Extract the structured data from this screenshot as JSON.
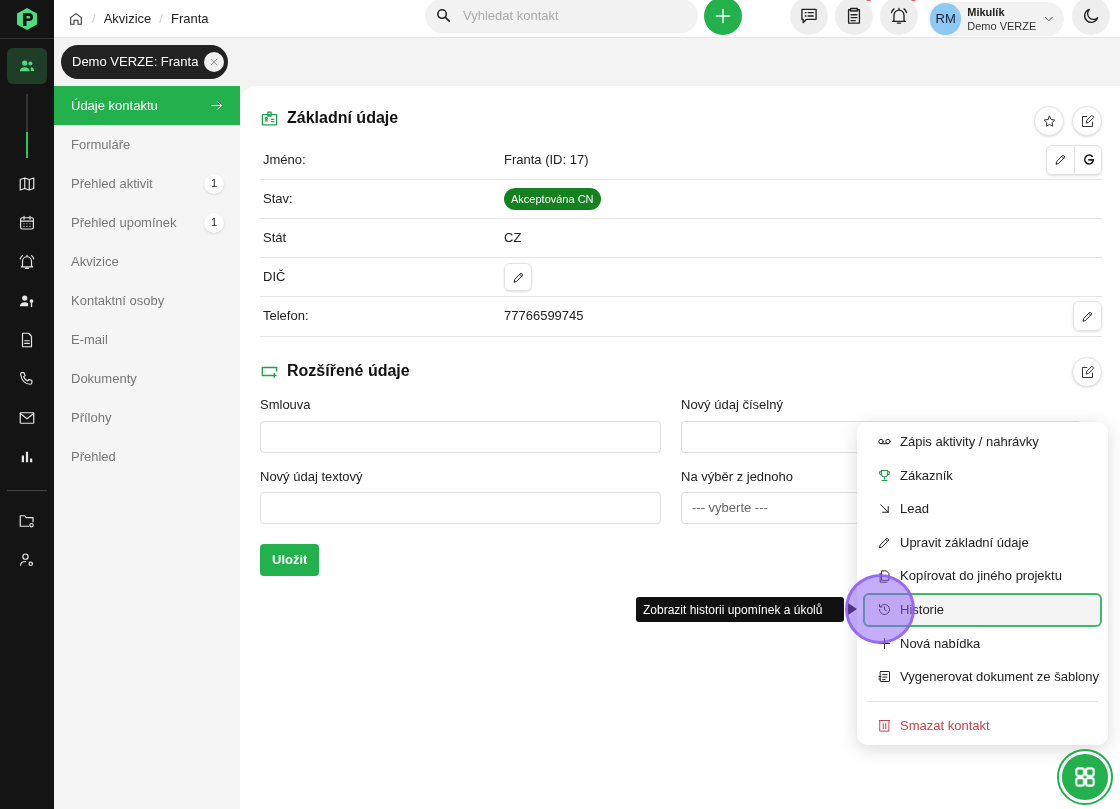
{
  "breadcrumb": [
    {
      "kind": "separator",
      "text": "/"
    },
    {
      "kind": "link",
      "text": "Akvizice"
    },
    {
      "kind": "separator",
      "text": "/"
    },
    {
      "kind": "link",
      "text": "Franta"
    }
  ],
  "search": {
    "placeholder": "Vyhledat kontakt"
  },
  "header_buttons": [
    {
      "kind": "chat",
      "badge": false
    },
    {
      "kind": "clipboard",
      "badge": true
    },
    {
      "kind": "bell",
      "badge": true
    }
  ],
  "user": {
    "initials": "RM",
    "name": "Mikulík",
    "project": "Demo VERZE"
  },
  "rail": [
    {
      "kind": "users",
      "selected": true
    },
    {
      "kind": "map",
      "selected": false
    },
    {
      "kind": "calendar",
      "selected": false
    },
    {
      "kind": "bell",
      "selected": false
    },
    {
      "kind": "user-key",
      "selected": false
    },
    {
      "kind": "document",
      "selected": false
    },
    {
      "kind": "phone",
      "selected": false
    },
    {
      "kind": "mail",
      "selected": false
    },
    {
      "kind": "chart",
      "selected": false
    },
    {
      "kind": "folder-gear",
      "selected": false
    },
    {
      "kind": "user-gear",
      "selected": false
    }
  ],
  "chip": {
    "label": "Demo VERZE: Franta"
  },
  "nav": [
    {
      "label": "Údaje kontaktu",
      "selected": true
    },
    {
      "label": "Formuláře",
      "selected": false
    },
    {
      "label": "Přehled aktivit",
      "selected": false,
      "badge": "1"
    },
    {
      "label": "Přehled upomínek",
      "selected": false,
      "badge": "1"
    },
    {
      "label": "Akvizice",
      "selected": false
    },
    {
      "label": "Kontaktní osoby",
      "selected": false
    },
    {
      "label": "E-mail",
      "selected": false
    },
    {
      "label": "Dokumenty",
      "selected": false
    },
    {
      "label": "Přílohy",
      "selected": false
    },
    {
      "label": "Přehled",
      "selected": false
    }
  ],
  "basic": {
    "title": "Základní údaje",
    "rows": [
      {
        "label": "Jméno:",
        "kind": "text",
        "value": "Franta (ID: 17)",
        "edit": true,
        "google": true
      },
      {
        "label": "Stav:",
        "kind": "badge",
        "value": "Akceptována CN"
      },
      {
        "label": "Stát",
        "kind": "text",
        "value": "CZ"
      },
      {
        "label": "DIČ",
        "kind": "edit_only"
      },
      {
        "label": "Telefon:",
        "kind": "text",
        "value": "77766599745",
        "edit": true,
        "google": false
      }
    ]
  },
  "extended": {
    "title": "Rozšířené údaje",
    "fields": [
      {
        "label": "Smlouva",
        "kind": "input"
      },
      {
        "label": "Nový údaj číselný",
        "kind": "input"
      },
      {
        "label": "Nový údaj textový",
        "kind": "input"
      },
      {
        "label": "Na výběr z jednoho",
        "kind": "select",
        "value": "--- vyberte ---"
      }
    ],
    "save": "Uložit"
  },
  "menu": [
    {
      "label": "Zápis aktivity / nahrávky",
      "kind": "recording",
      "selected": false
    },
    {
      "label": "Zákazník",
      "kind": "trophy",
      "selected": false
    },
    {
      "label": "Lead",
      "kind": "arrow",
      "selected": false
    },
    {
      "label": "Upravit základní údaje",
      "kind": "pencil",
      "selected": false
    },
    {
      "label": "Kopírovat do jiného projektu",
      "kind": "copy",
      "selected": false
    },
    {
      "label": "Historie",
      "kind": "history",
      "selected": true
    },
    {
      "label": "Nová nabídka",
      "kind": "plus",
      "selected": false
    },
    {
      "label": "Vygenerovat dokument ze šablony",
      "kind": "template",
      "selected": false
    },
    {
      "label": "Smazat kontakt",
      "kind": "delete",
      "selected": false
    }
  ],
  "tooltip": "Zobrazit historii upomínek a úkolů"
}
